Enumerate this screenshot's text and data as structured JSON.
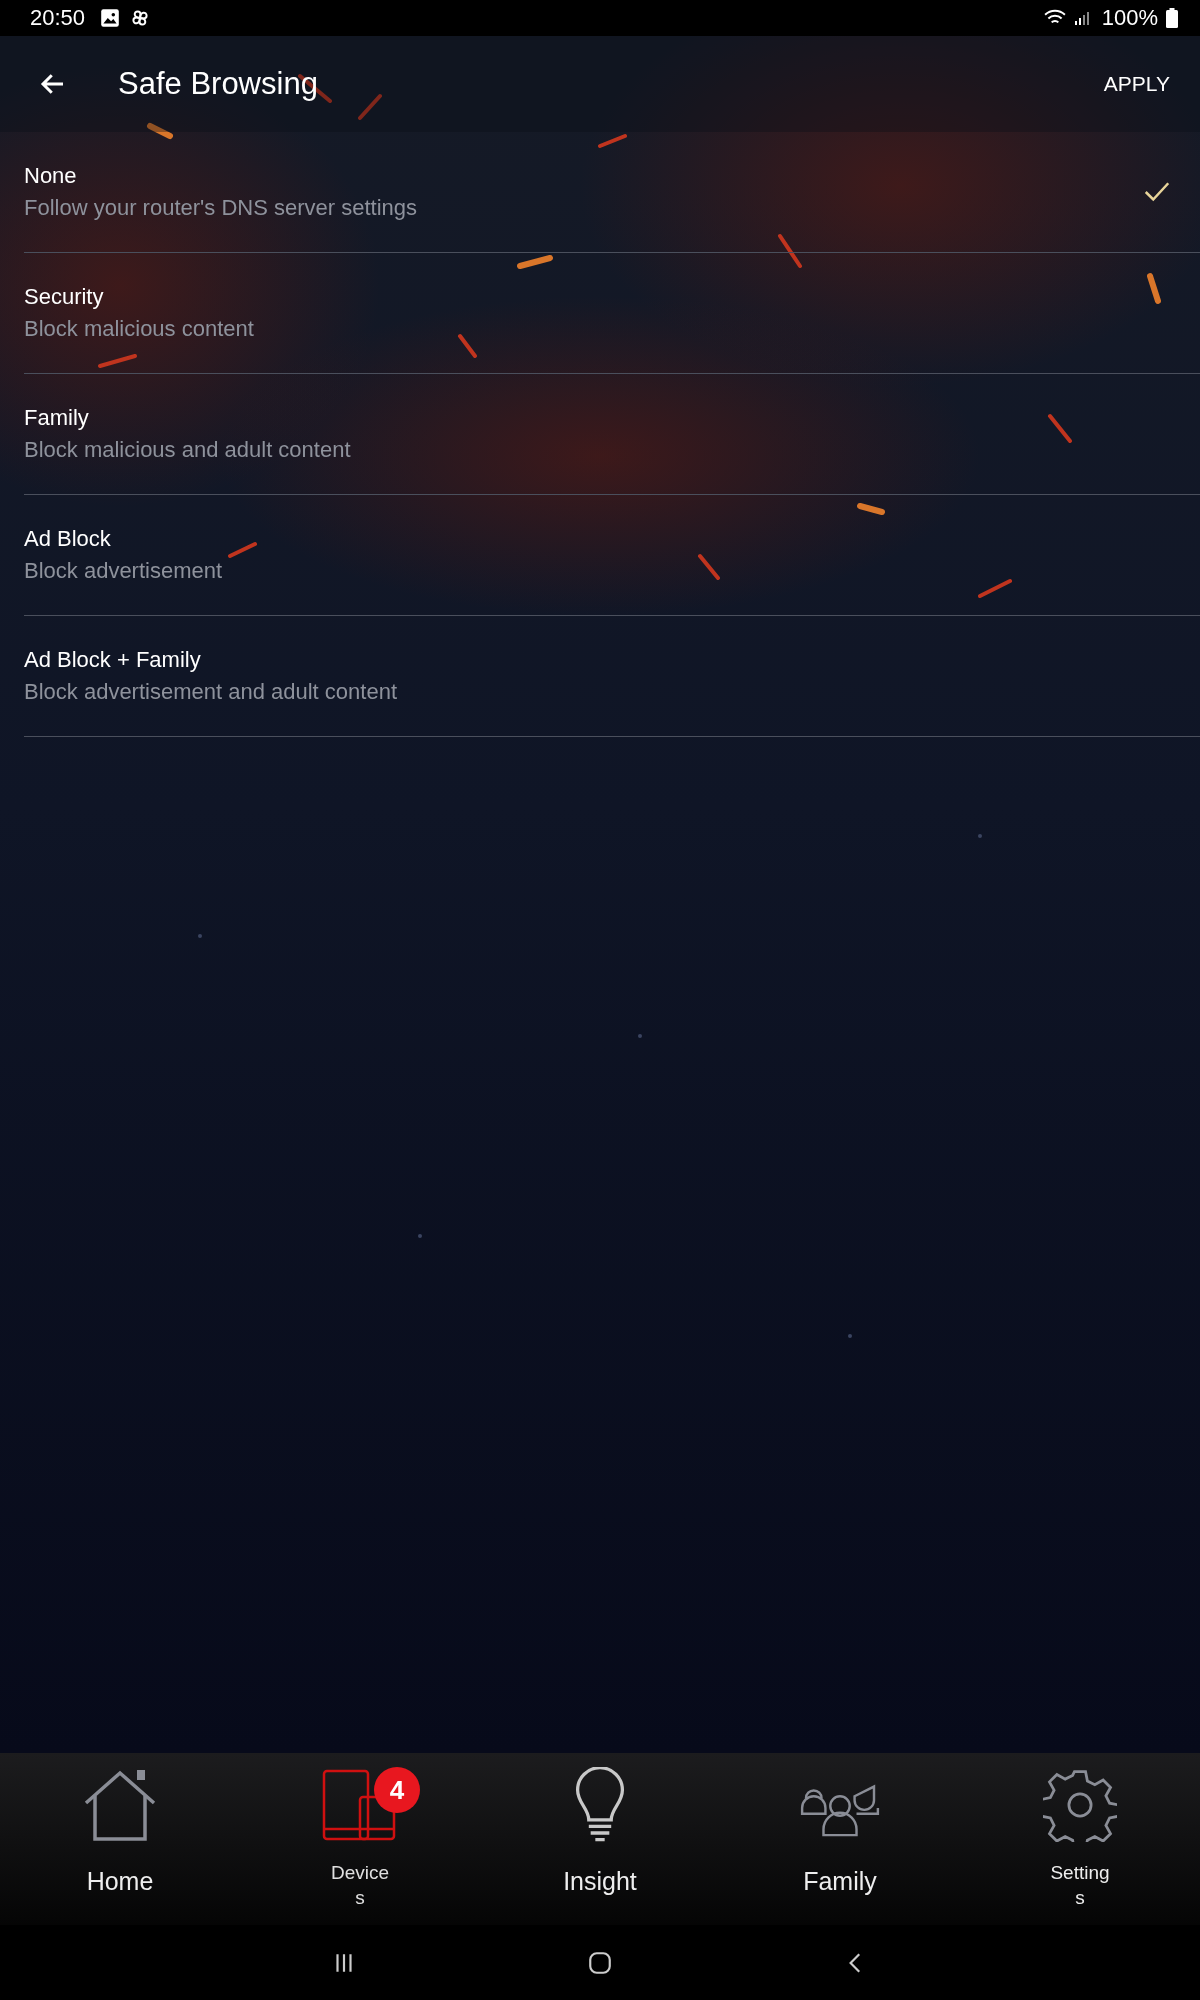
{
  "status_bar": {
    "time": "20:50",
    "battery": "100%"
  },
  "header": {
    "title": "Safe Browsing",
    "action": "APPLY"
  },
  "options": [
    {
      "title": "None",
      "subtitle": "Follow your router's DNS server settings",
      "selected": true
    },
    {
      "title": "Security",
      "subtitle": "Block malicious content",
      "selected": false
    },
    {
      "title": "Family",
      "subtitle": "Block malicious and adult content",
      "selected": false
    },
    {
      "title": "Ad Block",
      "subtitle": "Block advertisement",
      "selected": false
    },
    {
      "title": "Ad Block + Family",
      "subtitle": "Block advertisement and adult content",
      "selected": false
    }
  ],
  "bottom_nav": [
    {
      "kind": "home",
      "label": "Home",
      "selected": false
    },
    {
      "kind": "devices",
      "label": "Devices",
      "selected": true,
      "badge": "4"
    },
    {
      "kind": "insight",
      "label": "Insight",
      "selected": false
    },
    {
      "kind": "family",
      "label": "Family",
      "selected": false
    },
    {
      "kind": "settings",
      "label": "Settings",
      "selected": false
    }
  ]
}
